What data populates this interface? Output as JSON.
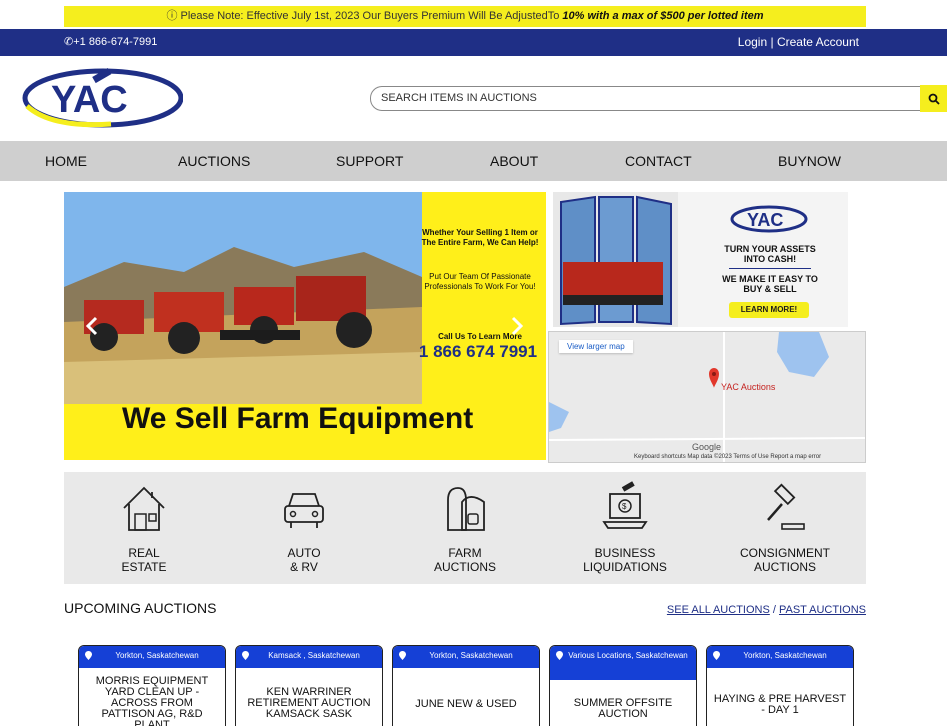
{
  "notice": {
    "prefix": "ⓘ Please Note:  Effective July 1st, 2023 Our Buyers Premium Will Be AdjustedTo ",
    "highlight": "10% with a max of $500 per lotted item"
  },
  "topbar": {
    "phone": "✆+1 866-674-7991",
    "login": "Login",
    "separator": " | ",
    "create": "Create Account"
  },
  "logo": {
    "text": "YAC"
  },
  "search": {
    "placeholder": "SEARCH ITEMS IN AUCTIONS"
  },
  "nav": [
    "HOME",
    "AUCTIONS",
    "SUPPORT",
    "ABOUT",
    "CONTACT",
    "BUYNOW"
  ],
  "hero": {
    "pitch": "Whether Your Selling 1 Item or The Entire Farm, We Can Help!",
    "pitch2": "Put Our Team Of Passionate Professionals To Work For You!",
    "cta": "Call Us To Learn More",
    "phone": "1 866 674 7991",
    "title": "We Sell Farm Equipment"
  },
  "promo": {
    "logo": "YAC",
    "line1": "TURN YOUR ASSETS INTO CASH!",
    "line2": "WE MAKE IT EASY TO BUY & SELL",
    "button": "LEARN MORE!"
  },
  "map": {
    "larger": "View larger map",
    "pin": "YAC Auctions",
    "brand": "Google",
    "footer": "Keyboard shortcuts   Map data ©2023   Terms of Use   Report a map error"
  },
  "categories": [
    {
      "line1": "REAL",
      "line2": "ESTATE",
      "icon": "house-icon"
    },
    {
      "line1": "AUTO",
      "line2": "& RV",
      "icon": "car-icon"
    },
    {
      "line1": "FARM",
      "line2": "AUCTIONS",
      "icon": "barn-icon"
    },
    {
      "line1": "BUSINESS",
      "line2": "LIQUIDATIONS",
      "icon": "laptop-money-icon"
    },
    {
      "line1": "CONSIGNMENT",
      "line2": "AUCTIONS",
      "icon": "gavel-icon"
    }
  ],
  "upcoming": {
    "heading": "UPCOMING AUCTIONS",
    "see_all": "SEE ALL AUCTIONS",
    "slash": " / ",
    "past": "PAST AUCTIONS"
  },
  "auctions": [
    {
      "location": "Yorkton, Saskatchewan",
      "title": "MORRIS EQUIPMENT YARD CLEAN UP - ACROSS FROM PATTISON AG, R&D PLANT"
    },
    {
      "location": "Kamsack , Saskatchewan",
      "title": "KEN WARRINER RETIREMENT AUCTION KAMSACK SASK"
    },
    {
      "location": "Yorkton, Saskatchewan",
      "title": "JUNE NEW & USED"
    },
    {
      "location": "Various Locations, Saskatchewan",
      "title": "SUMMER OFFSITE AUCTION"
    },
    {
      "location": "Yorkton, Saskatchewan",
      "title": "HAYING & PRE HARVEST - DAY 1"
    }
  ],
  "colors": {
    "navy": "#1f2f86",
    "yellow": "#f5ee1e",
    "card_blue": "#1540d6"
  }
}
